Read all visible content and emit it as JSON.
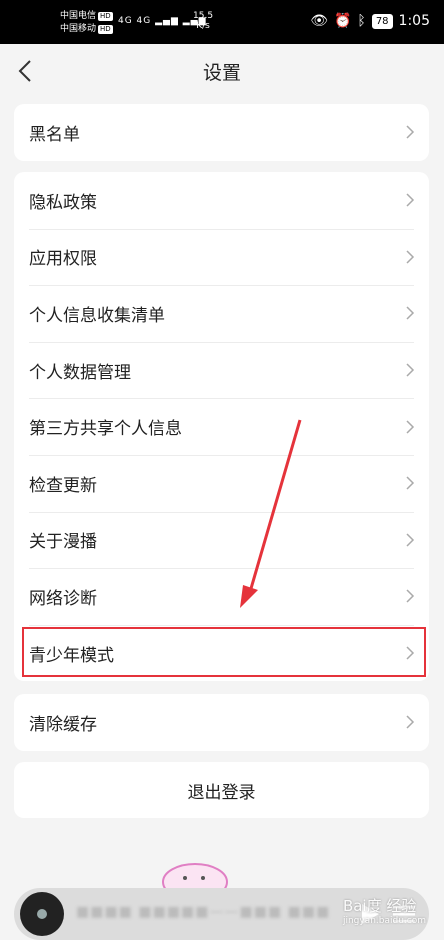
{
  "status_bar": {
    "carrier_1": "中国电信",
    "carrier_2": "中国移动",
    "hd": "HD",
    "network": "4G  4G",
    "speed_value": "15.5",
    "speed_unit": "K/s",
    "battery": "78",
    "time": "1:05"
  },
  "header": {
    "title": "设置"
  },
  "settings": {
    "blacklist": "黑名单",
    "items": [
      "隐私政策",
      "应用权限",
      "个人信息收集清单",
      "个人数据管理",
      "第三方共享个人信息",
      "检查更新",
      "关于漫播",
      "网络诊断",
      "青少年模式"
    ],
    "clear_cache": "清除缓存",
    "logout": "退出登录"
  },
  "player": {
    "track": "■■■■ ■■■■■——■■■  ■■■"
  },
  "watermark": {
    "brand": "Bai度 经验",
    "sub": "jingyan.baidu.com"
  },
  "colors": {
    "highlight": "#e5333b",
    "card": "#ffffff",
    "background": "#f4f4f4"
  }
}
